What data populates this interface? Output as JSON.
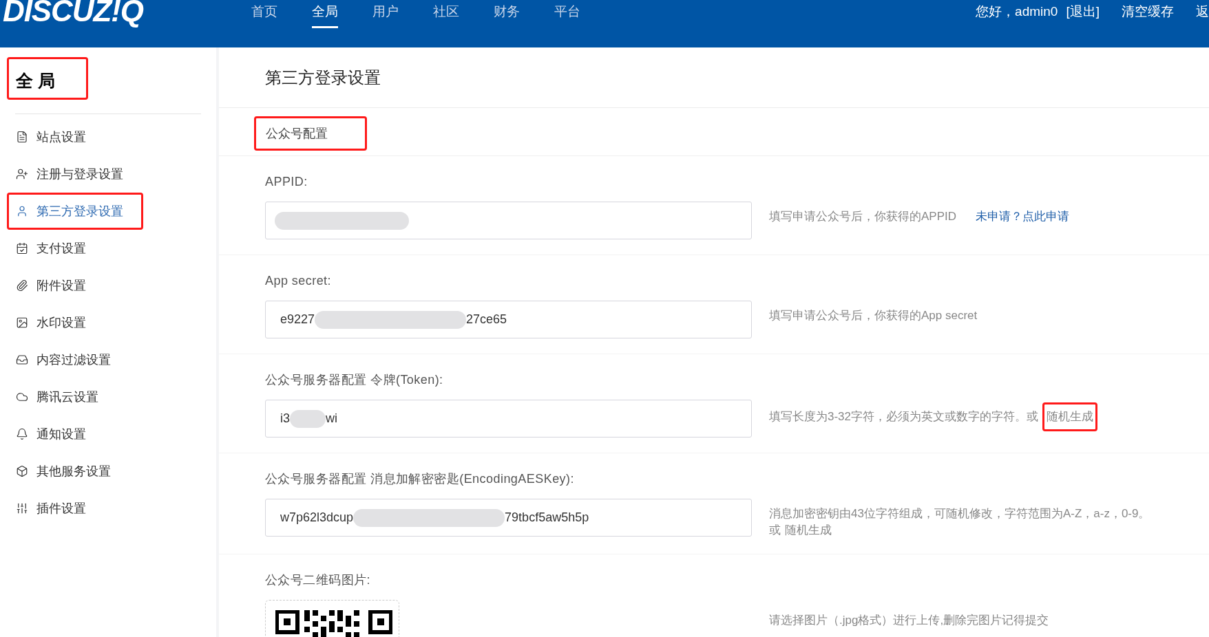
{
  "header": {
    "logo": "DISCUZ!Q",
    "nav": [
      {
        "label": "首页",
        "selected": false
      },
      {
        "label": "全局",
        "selected": true
      },
      {
        "label": "用户",
        "selected": false
      },
      {
        "label": "社区",
        "selected": false
      },
      {
        "label": "财务",
        "selected": false
      },
      {
        "label": "平台",
        "selected": false
      }
    ],
    "greeting": "您好，admin0",
    "logout": "[退出]",
    "actions": [
      "清空缓存",
      "返"
    ]
  },
  "sidebar": {
    "title": "全 局",
    "highlighted": true,
    "items": [
      {
        "label": "站点设置",
        "selected": false,
        "highlighted": false
      },
      {
        "label": "注册与登录设置",
        "selected": false,
        "highlighted": false
      },
      {
        "label": "第三方登录设置",
        "selected": true,
        "highlighted": true
      },
      {
        "label": "支付设置",
        "selected": false,
        "highlighted": false
      },
      {
        "label": "附件设置",
        "selected": false,
        "highlighted": false
      },
      {
        "label": "水印设置",
        "selected": false,
        "highlighted": false
      },
      {
        "label": "内容过滤设置",
        "selected": false,
        "highlighted": false
      },
      {
        "label": "腾讯云设置",
        "selected": false,
        "highlighted": false
      },
      {
        "label": "通知设置",
        "selected": false,
        "highlighted": false
      },
      {
        "label": "其他服务设置",
        "selected": false,
        "highlighted": false
      },
      {
        "label": "插件设置",
        "selected": false,
        "highlighted": false
      }
    ]
  },
  "main": {
    "title": "第三方登录设置",
    "subtab": {
      "label": "公众号配置",
      "highlighted": true
    },
    "fields": [
      {
        "kind": "text",
        "label": "APPID:",
        "hint": [
          [
            {
              "kind": "text",
              "text": "填写申请公众号后，你获得的APPID"
            },
            {
              "kind": "link",
              "text": "未申请？点此申请"
            }
          ]
        ]
      },
      {
        "kind": "text",
        "label": "App secret:",
        "value_parts": [
          "e9227",
          "27ce65"
        ],
        "hint": [
          [
            {
              "kind": "text",
              "text": "填写申请公众号后，你获得的App secret"
            }
          ]
        ]
      },
      {
        "kind": "text",
        "label": "公众号服务器配置 令牌(Token):",
        "value_parts": [
          "i3",
          "wi"
        ],
        "hint": [
          [
            {
              "kind": "text",
              "text": "填写长度为3-32字符，必须为英文或数字的字符。或"
            },
            {
              "kind": "action",
              "text": "随机生成",
              "highlighted": true
            }
          ]
        ]
      },
      {
        "kind": "text",
        "label": "公众号服务器配置 消息加解密密匙(EncodingAESKey):",
        "value_parts": [
          "w7p62l3dcup",
          "79tbcf5aw5h5p"
        ],
        "hint": [
          [
            {
              "kind": "text",
              "text": "消息加密密钥由43位字符组成，可随机修改，字符范围为A-Z，a-z，0-9。"
            }
          ],
          [
            {
              "kind": "text",
              "text": "或"
            },
            {
              "kind": "action",
              "text": "随机生成",
              "highlighted": false
            }
          ]
        ]
      },
      {
        "kind": "image",
        "label": "公众号二维码图片:",
        "hint": [
          [
            {
              "kind": "text",
              "text": "请选择图片（.jpg格式）进行上传,删除完图片记得提交"
            }
          ]
        ]
      }
    ]
  }
}
